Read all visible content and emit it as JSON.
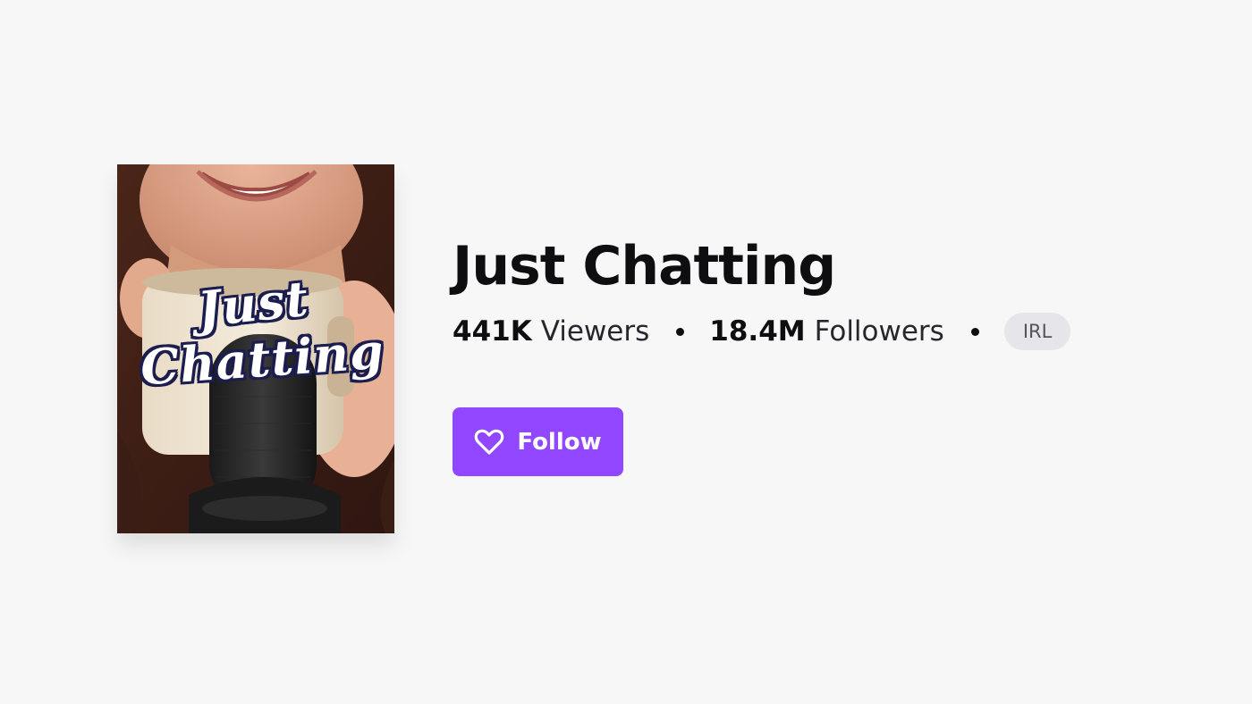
{
  "category": {
    "title": "Just Chatting",
    "boxart": {
      "title_line_1": "Just",
      "title_line_2": "Chatting"
    },
    "stats": {
      "viewers_count": "441K",
      "viewers_label": "Viewers",
      "followers_count": "18.4M",
      "followers_label": "Followers"
    },
    "tags": [
      "IRL"
    ],
    "follow_button": {
      "label": "Follow",
      "icon": "heart-outline-icon",
      "color": "#9147ff"
    }
  },
  "colors": {
    "background": "#f7f7f8",
    "accent": "#9147ff",
    "tag_background": "#e6e6ea"
  }
}
